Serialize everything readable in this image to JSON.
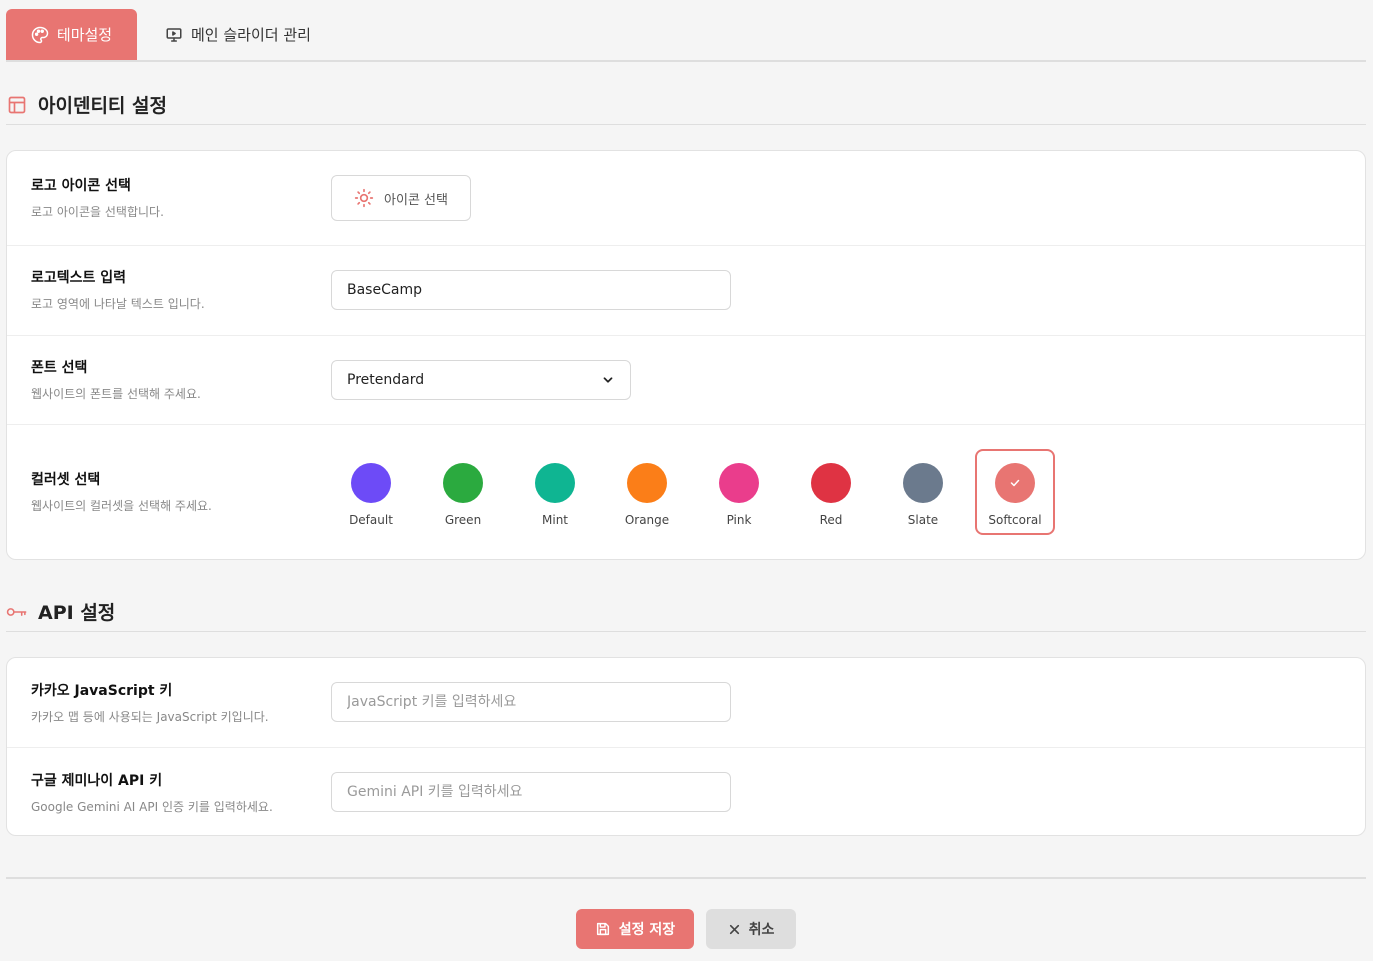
{
  "tabs": [
    {
      "label": "테마설정",
      "icon": "palette-icon",
      "active": true
    },
    {
      "label": "메인 슬라이더 관리",
      "icon": "presentation-icon",
      "active": false
    }
  ],
  "identity_section": {
    "title": "아이덴티티 설정",
    "icon": "layout-icon",
    "logo_icon": {
      "label": "로고 아이콘 선택",
      "desc": "로고 아이콘을 선택합니다.",
      "button_label": "아이콘 선택"
    },
    "logo_text": {
      "label": "로고텍스트 입력",
      "desc": "로고 영역에 나타날 텍스트 입니다.",
      "value": "BaseCamp"
    },
    "font": {
      "label": "폰트 선택",
      "desc": "웹사이트의 폰트를 선택해 주세요.",
      "selected": "Pretendard"
    },
    "colorset": {
      "label": "컬러셋 선택",
      "desc": "웹사이트의 컬러셋을 선택해 주세요.",
      "options": [
        {
          "name": "Default",
          "color": "#6d4bf7"
        },
        {
          "name": "Green",
          "color": "#2baa3f"
        },
        {
          "name": "Mint",
          "color": "#0fb592"
        },
        {
          "name": "Orange",
          "color": "#fb7e18"
        },
        {
          "name": "Pink",
          "color": "#ea3d8c"
        },
        {
          "name": "Red",
          "color": "#df3343"
        },
        {
          "name": "Slate",
          "color": "#6b7a8d"
        },
        {
          "name": "Softcoral",
          "color": "#e87572"
        }
      ],
      "selected": "Softcoral"
    }
  },
  "api_section": {
    "title": "API 설정",
    "icon": "key-icon",
    "kakao": {
      "label": "카카오 JavaScript 키",
      "desc": "카카오 맵 등에 사용되는 JavaScript 키입니다.",
      "value": "",
      "placeholder": "JavaScript 키를 입력하세요"
    },
    "gemini": {
      "label": "구글 제미나이 API 키",
      "desc": "Google Gemini AI API 인증 키를 입력하세요.",
      "value": "",
      "placeholder": "Gemini API 키를 입력하세요"
    }
  },
  "actions": {
    "save_label": "설정 저장",
    "cancel_label": "취소"
  },
  "colors": {
    "accent": "#e87572",
    "cancel_bg": "#dedede"
  }
}
